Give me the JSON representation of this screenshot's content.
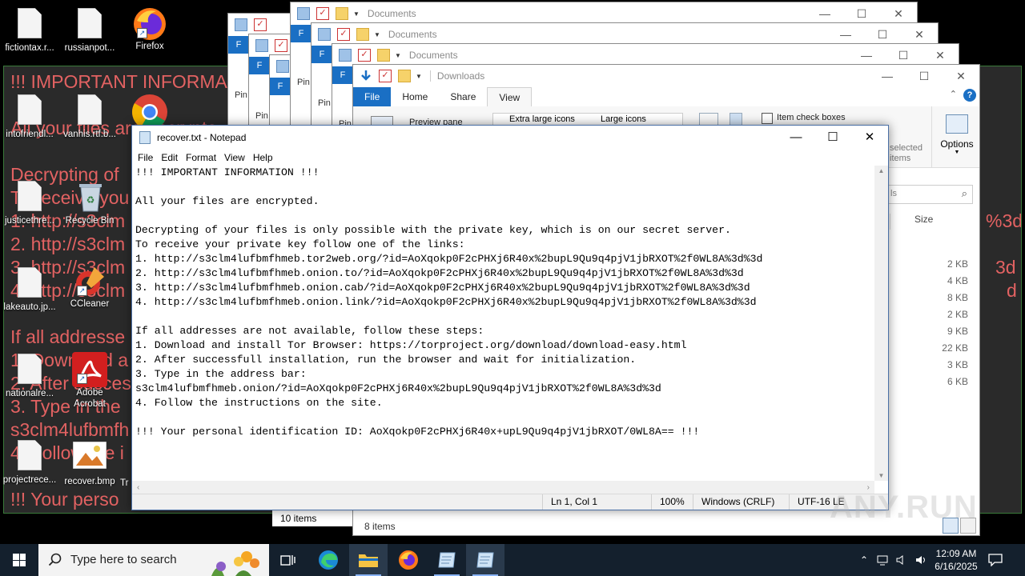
{
  "wallpaper": {
    "lines": [
      "!!! IMPORTANT INFORMA",
      "All your files are encrypte",
      "Decrypting of",
      "To receive you",
      "1. http://s3clm",
      "2. http://s3clm",
      "3. http://s3clm",
      "4. http://s3clm",
      "If all addresse",
      "1. Download a",
      "2. After succes",
      "3. Type in the",
      "s3clm4lufbmfh",
      "4. Follow the i",
      "!!! Your perso"
    ],
    "right_fragments": [
      "%3d",
      "3d",
      "d"
    ]
  },
  "desktop_icons": [
    {
      "label": "fictiontax.r...",
      "icon": "document-icon"
    },
    {
      "label": "russianpot...",
      "icon": "document-icon"
    },
    {
      "label": "Firefox",
      "icon": "firefox-icon"
    },
    {
      "label": "intofriendl...",
      "icon": "document-icon"
    },
    {
      "label": "vanhis.rtf.b...",
      "icon": "document-icon"
    },
    {
      "label": "Chrome",
      "icon": "chrome-icon"
    },
    {
      "label": "justicethre...",
      "icon": "document-icon"
    },
    {
      "label": "Recycle Bin",
      "icon": "recycle-bin-icon"
    },
    {
      "label": "lakeauto.jp...",
      "icon": "document-icon"
    },
    {
      "label": "CCleaner",
      "icon": "ccleaner-icon"
    },
    {
      "label": "nationalre...",
      "icon": "document-icon"
    },
    {
      "label": "Adobe Acrobat",
      "icon": "acrobat-icon"
    },
    {
      "label": "projectrece...",
      "icon": "document-icon"
    },
    {
      "label": "recover.bmp",
      "icon": "image-icon"
    },
    {
      "label": "Tr",
      "icon": "document-icon"
    }
  ],
  "explorer": {
    "window_titles": [
      "Documents",
      "Documents",
      "Documents",
      "Downloads"
    ],
    "pin_label": "Pin",
    "file_strip_label": "F",
    "tabs": {
      "file": "File",
      "home": "Home",
      "share": "Share",
      "view": "View"
    },
    "layout_options": {
      "extra_large": "Extra large icons",
      "large": "Large icons"
    },
    "preview_pane": "Preview pane",
    "item_check_boxes": "Item check boxes",
    "options": "Options",
    "selected_items_1": "selected",
    "selected_items_2": "items",
    "search_fragment": "ls",
    "size_header": "Size",
    "sizes": [
      "2 KB",
      "4 KB",
      "8 KB",
      "2 KB",
      "9 KB",
      "22 KB",
      "3 KB",
      "6 KB"
    ],
    "left_status": "10 items",
    "status": "8 items"
  },
  "notepad": {
    "title": "recover.txt - Notepad",
    "menu": [
      "File",
      "Edit",
      "Format",
      "View",
      "Help"
    ],
    "content": "!!! IMPORTANT INFORMATION !!!\n\nAll your files are encrypted.\n\nDecrypting of your files is only possible with the private key, which is on our secret server.\nTo receive your private key follow one of the links:\n1. http://s3clm4lufbmfhmeb.tor2web.org/?id=AoXqokp0F2cPHXj6R40x%2bupL9Qu9q4pjV1jbRXOT%2f0WL8A%3d%3d\n2. http://s3clm4lufbmfhmeb.onion.to/?id=AoXqokp0F2cPHXj6R40x%2bupL9Qu9q4pjV1jbRXOT%2f0WL8A%3d%3d\n3. http://s3clm4lufbmfhmeb.onion.cab/?id=AoXqokp0F2cPHXj6R40x%2bupL9Qu9q4pjV1jbRXOT%2f0WL8A%3d%3d\n4. http://s3clm4lufbmfhmeb.onion.link/?id=AoXqokp0F2cPHXj6R40x%2bupL9Qu9q4pjV1jbRXOT%2f0WL8A%3d%3d\n\nIf all addresses are not available, follow these steps:\n1. Download and install Tor Browser: https://torproject.org/download/download-easy.html\n2. After successfull installation, run the browser and wait for initialization.\n3. Type in the address bar:\ns3clm4lufbmfhmeb.onion/?id=AoXqokp0F2cPHXj6R40x%2bupL9Qu9q4pjV1jbRXOT%2f0WL8A%3d%3d\n4. Follow the instructions on the site.\n\n!!! Your personal identification ID: AoXqokp0F2cPHXj6R40x+upL9Qu9q4pjV1jbRXOT/0WL8A== !!!",
    "status": {
      "position": "Ln 1, Col 1",
      "zoom": "100%",
      "line_ending": "Windows (CRLF)",
      "encoding": "UTF-16 LE"
    }
  },
  "taskbar": {
    "search_placeholder": "Type here to search",
    "time": "12:09 AM",
    "date": "6/16/2025"
  },
  "watermark": "ANY.RUN"
}
